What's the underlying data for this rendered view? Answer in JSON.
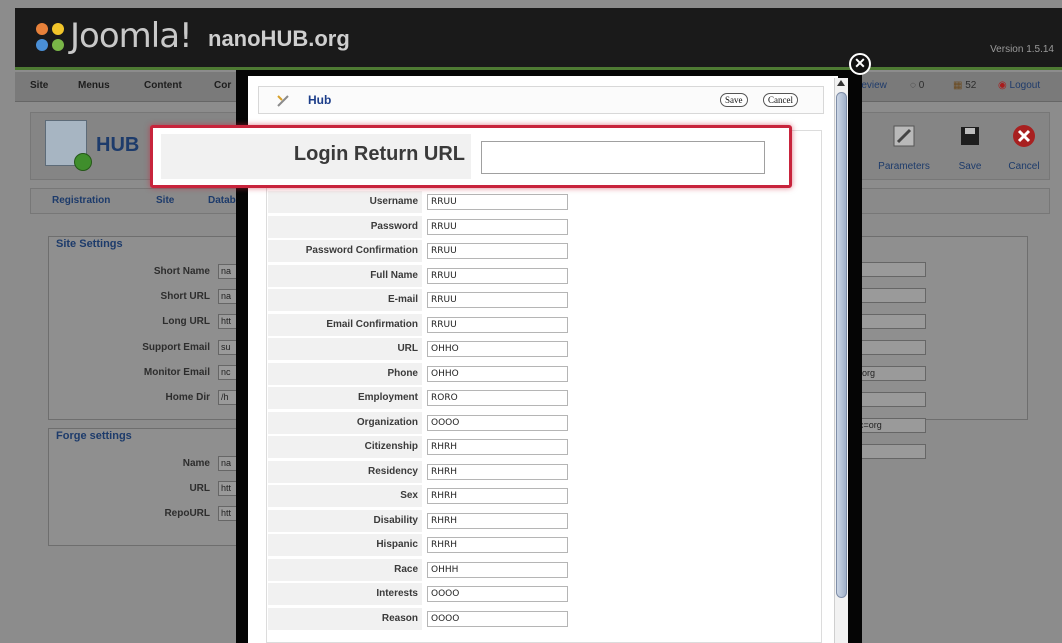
{
  "app": {
    "logo_text": "Joomla!",
    "site_title": "nanoHUB.org",
    "version": "Version 1.5.14"
  },
  "menu": {
    "items": [
      "Site",
      "Menus",
      "Content",
      "Cor"
    ],
    "status": {
      "preview": "review",
      "count1": "0",
      "count2": "52",
      "logout": "Logout"
    }
  },
  "toolbar": {
    "title": "HUB",
    "buttons": [
      {
        "label": "Parameters",
        "icon": "parameters-icon"
      },
      {
        "label": "Save",
        "icon": "save-icon"
      },
      {
        "label": "Cancel",
        "icon": "cancel-icon"
      }
    ]
  },
  "tabs": [
    "Registration",
    "Site",
    "Datab"
  ],
  "site_settings": {
    "legend": "Site Settings",
    "fields": [
      {
        "label": "Short Name",
        "value": "na"
      },
      {
        "label": "Short URL",
        "value": "na"
      },
      {
        "label": "Long URL",
        "value": "htt"
      },
      {
        "label": "Support Email",
        "value": "su"
      },
      {
        "label": "Monitor Email",
        "value": "nc"
      },
      {
        "label": "Home Dir",
        "value": "/h"
      }
    ],
    "right_values": [
      "",
      "",
      "",
      "",
      "-org",
      "",
      "c=org",
      ""
    ]
  },
  "forge_settings": {
    "legend": "Forge settings",
    "fields": [
      {
        "label": "Name",
        "value": "na"
      },
      {
        "label": "URL",
        "value": "htt"
      },
      {
        "label": "RepoURL",
        "value": "htt"
      }
    ]
  },
  "modal": {
    "title": "Hub",
    "save_label": "Save",
    "cancel_label": "Cancel",
    "close_glyph": "✕",
    "callout": {
      "label": "Login Return URL",
      "value": ""
    },
    "fields": [
      {
        "label": "Username",
        "value": "RRUU"
      },
      {
        "label": "Password",
        "value": "RRUU"
      },
      {
        "label": "Password Confirmation",
        "value": "RRUU"
      },
      {
        "label": "Full Name",
        "value": "RRUU"
      },
      {
        "label": "E-mail",
        "value": "RRUU"
      },
      {
        "label": "Email Confirmation",
        "value": "RRUU"
      },
      {
        "label": "URL",
        "value": "OHHO"
      },
      {
        "label": "Phone",
        "value": "OHHO"
      },
      {
        "label": "Employment",
        "value": "RORO"
      },
      {
        "label": "Organization",
        "value": "OOOO"
      },
      {
        "label": "Citizenship",
        "value": "RHRH"
      },
      {
        "label": "Residency",
        "value": "RHRH"
      },
      {
        "label": "Sex",
        "value": "RHRH"
      },
      {
        "label": "Disability",
        "value": "RHRH"
      },
      {
        "label": "Hispanic",
        "value": "RHRH"
      },
      {
        "label": "Race",
        "value": "OHHH"
      },
      {
        "label": "Interests",
        "value": "OOOO"
      },
      {
        "label": "Reason",
        "value": "OOOO"
      }
    ]
  },
  "colors": {
    "accent_red": "#c8243c",
    "link_blue": "#1d3e8a",
    "joomla_green": "#4e7a33"
  }
}
